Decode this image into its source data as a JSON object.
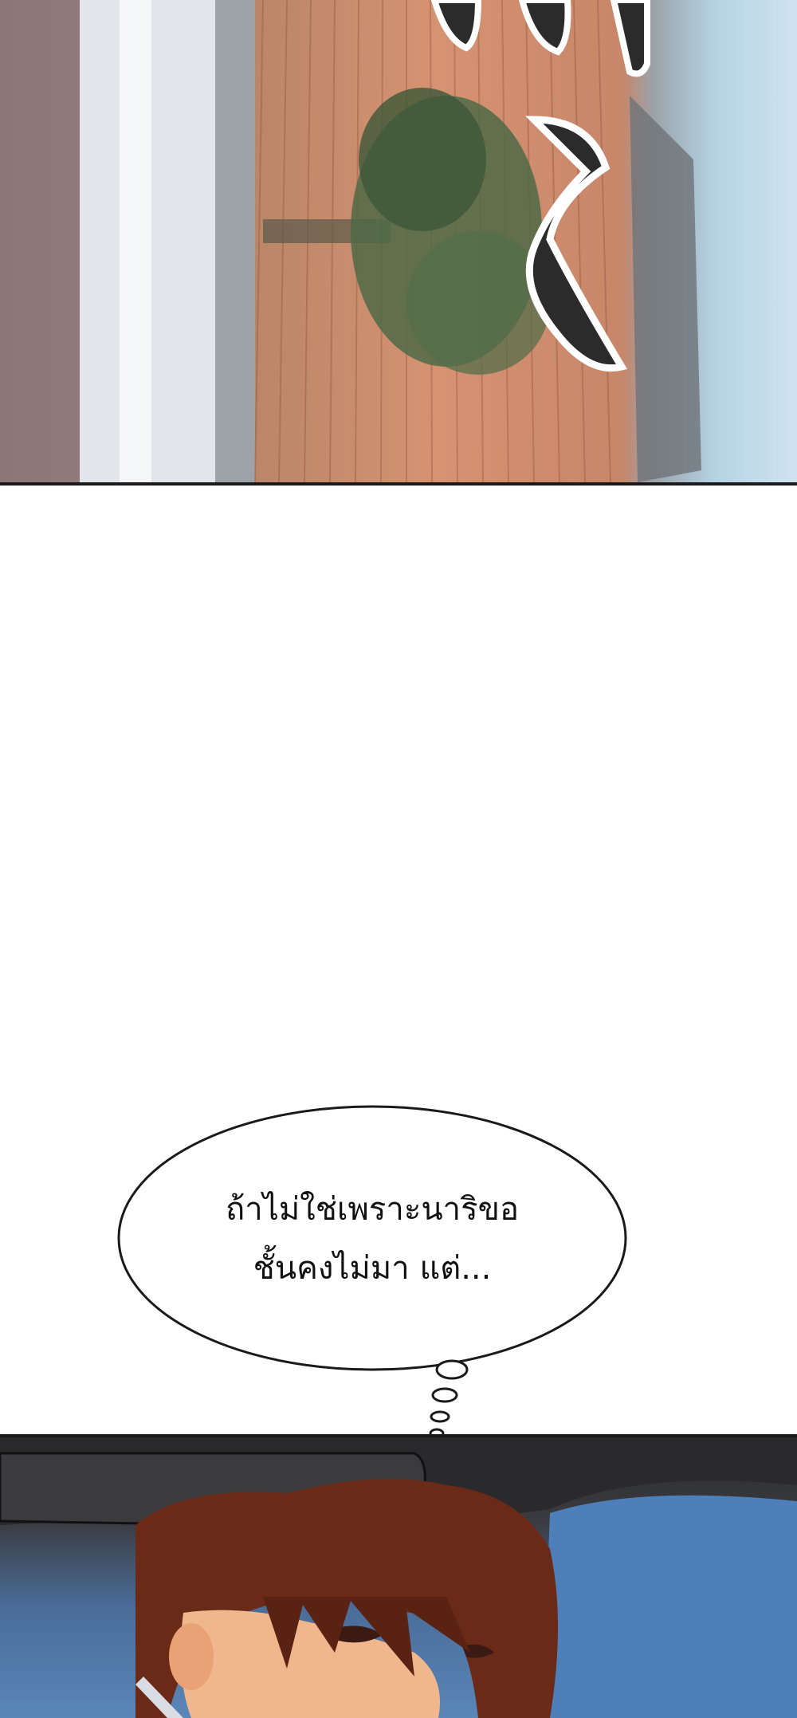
{
  "speech_bubble": {
    "line_1": "ถ้าไม่ใช่เพราะนาริขอ",
    "line_2": "ชั้นคงไม่มา แต่..."
  },
  "colors": {
    "panel_border": "#1b1b1b",
    "bubble_fill": "#ffffff",
    "bubble_stroke": "#1a1a1a",
    "background": "#ffffff"
  }
}
